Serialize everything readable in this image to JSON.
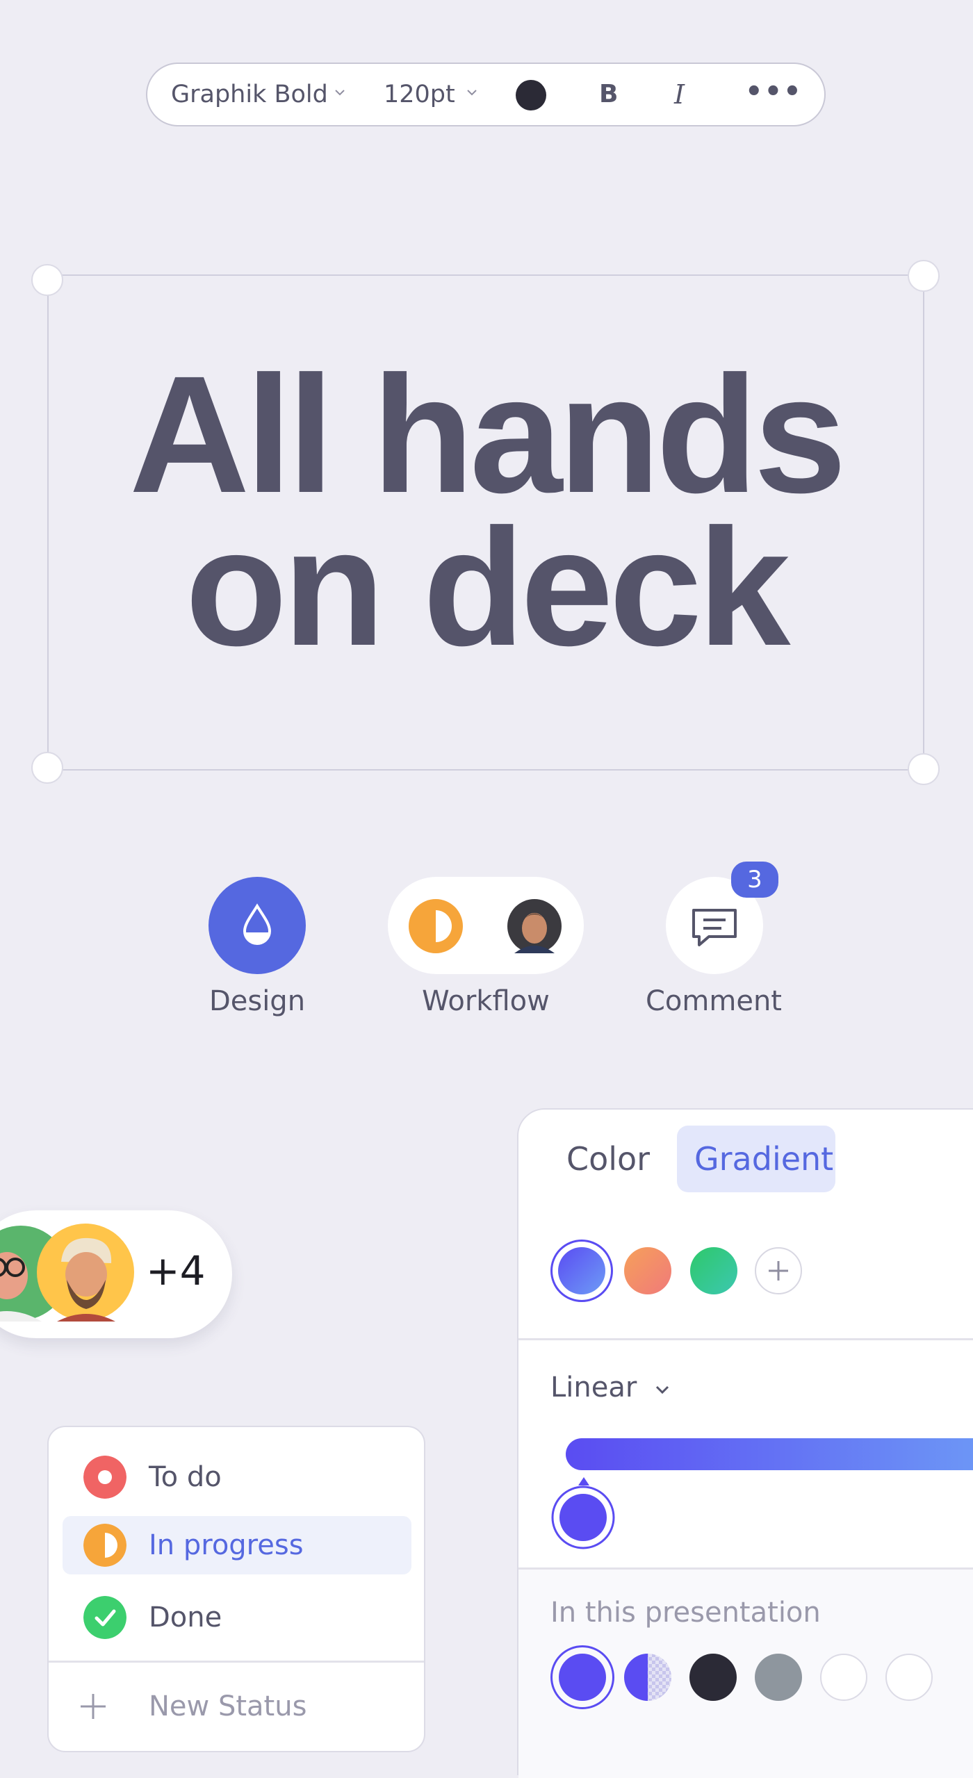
{
  "toolbar": {
    "font_family": "Graphik Bold",
    "font_size": "120pt",
    "bold_label": "B",
    "italic_label": "I",
    "more_label": "•••",
    "text_color": "#2b2a36"
  },
  "canvas": {
    "headline_line1": "All hands",
    "headline_line2": "on deck"
  },
  "tools": {
    "design_label": "Design",
    "workflow_label": "Workflow",
    "comment_label": "Comment",
    "comment_count": "3",
    "accent": "#5568e0"
  },
  "collaborators": {
    "extra_count": "+4"
  },
  "status_menu": {
    "items": [
      {
        "label": "To do",
        "icon": "record-icon",
        "color": "#f06464"
      },
      {
        "label": "In progress",
        "icon": "half-circle-icon",
        "color": "#f6a53a"
      },
      {
        "label": "Done",
        "icon": "check-icon",
        "color": "#3ccf6e"
      }
    ],
    "new_status_label": "New Status"
  },
  "color_panel": {
    "tab_color": "Color",
    "tab_gradient": "Gradient",
    "gradient_type": "Linear",
    "presentation_label": "In this presentation",
    "gradient_start": "#5a4cf2",
    "gradient_end": "#6e9cf6"
  }
}
